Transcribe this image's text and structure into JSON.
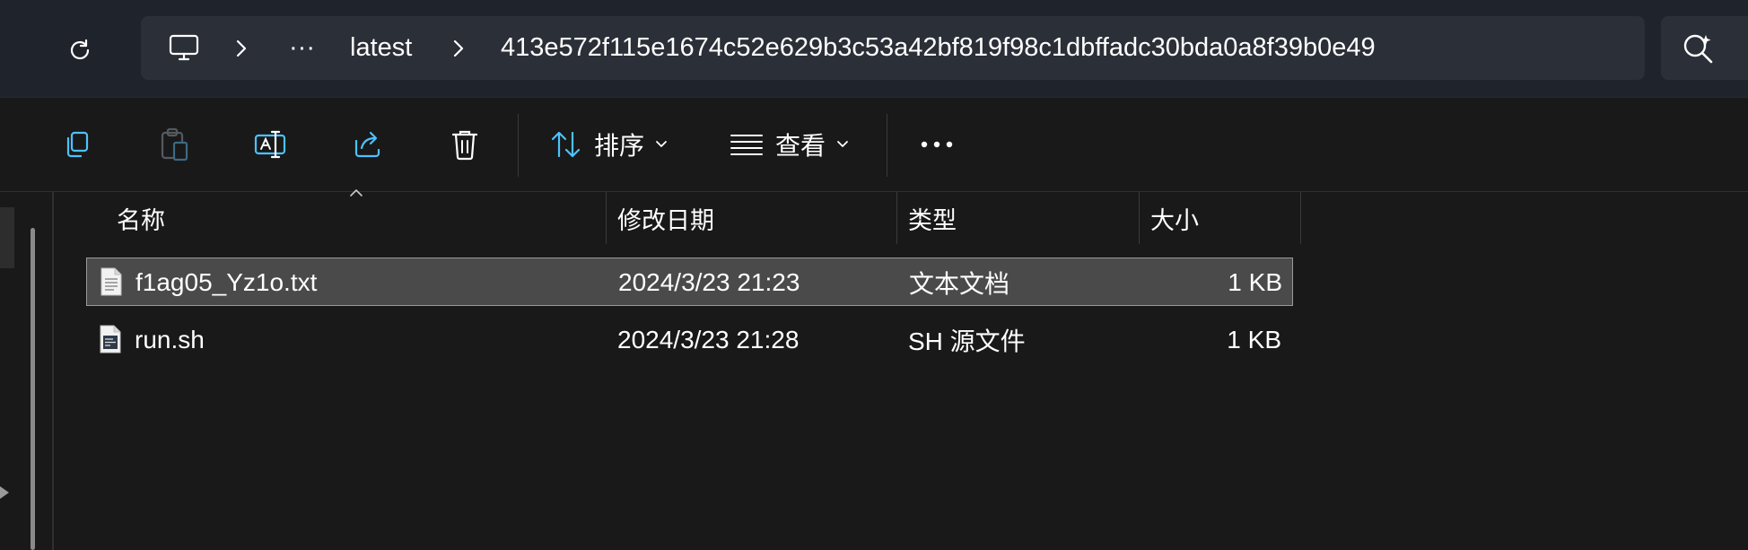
{
  "address_bar": {
    "path": [
      "latest",
      "413e572f115e1674c52e629b3c53a42bf819f98c1dbffadc30bda0a8f39b0e49"
    ],
    "overflow_label": "···",
    "icons": [
      "refresh-icon",
      "this-pc-icon",
      "chevron-right-icon",
      "search-icon"
    ]
  },
  "command_bar": {
    "sort_label": "排序",
    "view_label": "查看",
    "more_label": "···",
    "icons": [
      "copy-icon",
      "paste-icon",
      "rename-icon",
      "share-icon",
      "delete-icon",
      "sort-icon",
      "view-icon",
      "chevron-down-icon",
      "more-icon"
    ]
  },
  "columns": [
    "名称",
    "修改日期",
    "类型",
    "大小"
  ],
  "files": [
    {
      "name": "f1ag05_Yz1o.txt",
      "modified": "2024/3/23 21:23",
      "type": "文本文档",
      "size": "1 KB",
      "selected": true,
      "icon": "text-file-icon"
    },
    {
      "name": "run.sh",
      "modified": "2024/3/23 21:28",
      "type": "SH 源文件",
      "size": "1 KB",
      "selected": false,
      "icon": "script-file-icon"
    }
  ],
  "colors": {
    "background": "#191919",
    "address_region": "#1f232b",
    "address_box": "#2b2f37",
    "selected_row": "#4a4a4a",
    "accent_icon": "#4cc2ff"
  }
}
